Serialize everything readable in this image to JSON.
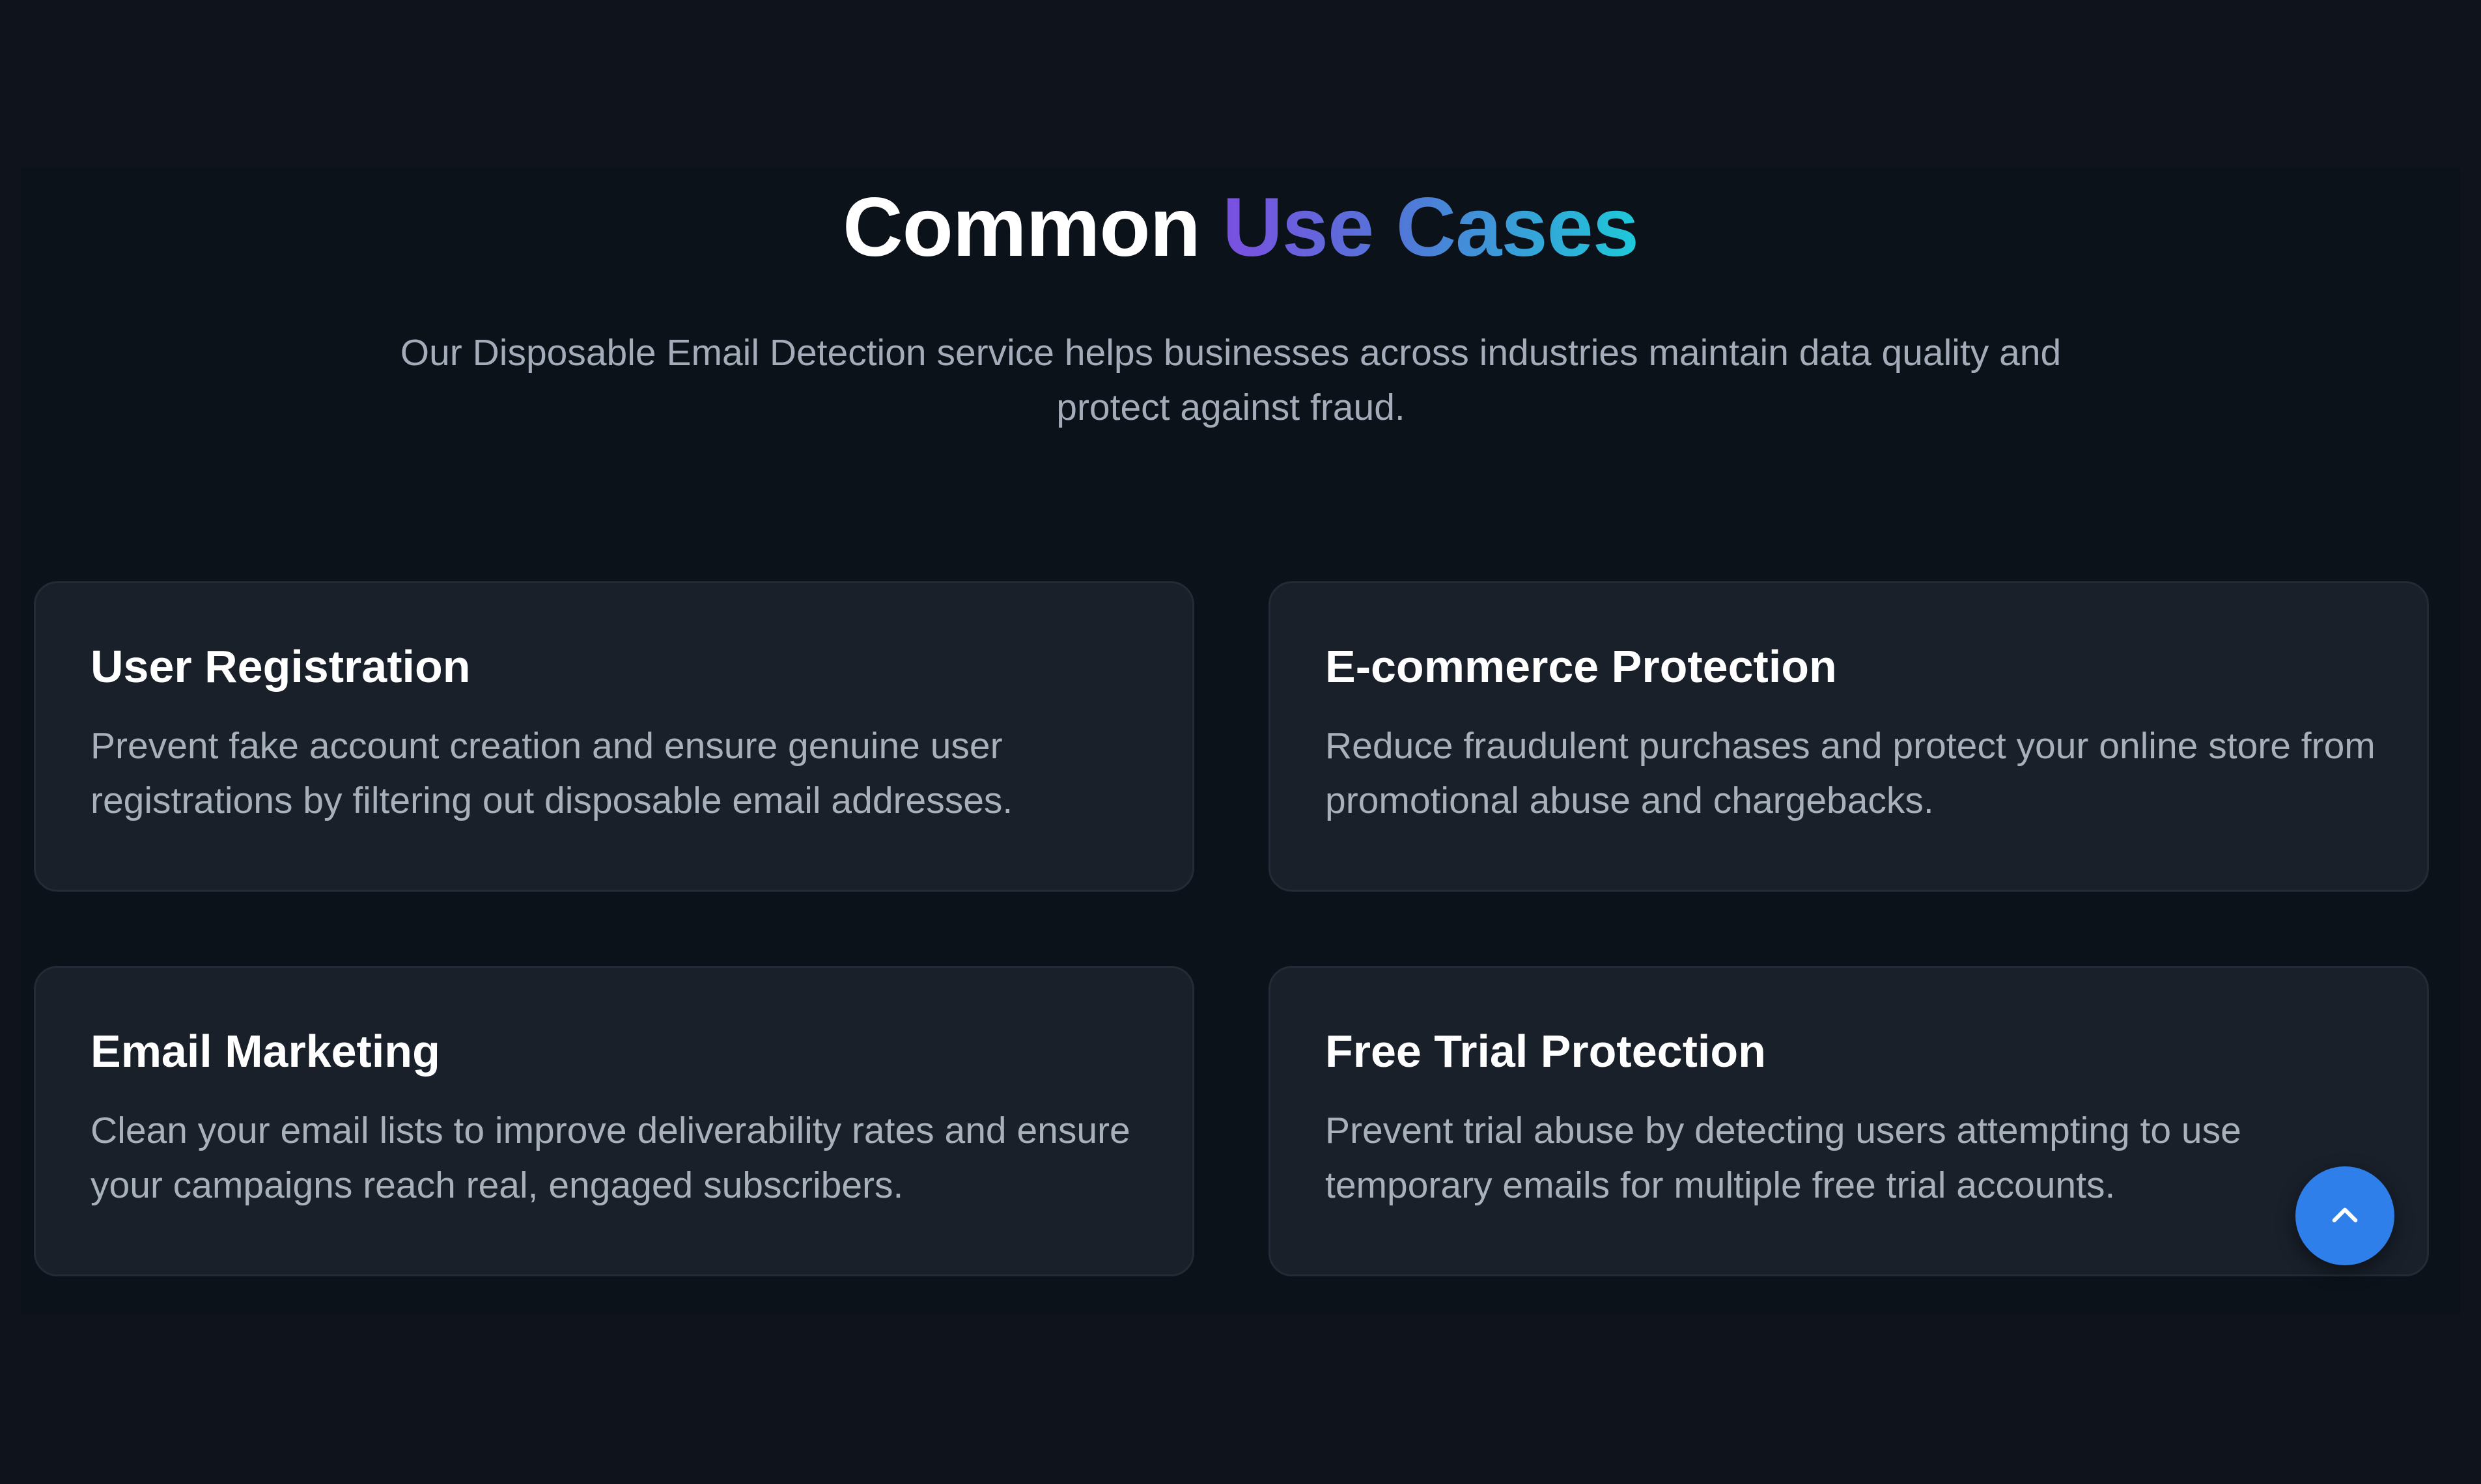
{
  "heading": {
    "part1": "Common ",
    "part2": "Use Cases"
  },
  "subtitle": "Our Disposable Email Detection service helps businesses across industries maintain data quality and protect against fraud.",
  "cards": [
    {
      "title": "User Registration",
      "description": "Prevent fake account creation and ensure genuine user registrations by filtering out disposable email addresses."
    },
    {
      "title": "E-commerce Protection",
      "description": "Reduce fraudulent purchases and protect your online store from promotional abuse and chargebacks."
    },
    {
      "title": "Email Marketing",
      "description": "Clean your email lists to improve deliverability rates and ensure your campaigns reach real, engaged subscribers."
    },
    {
      "title": "Free Trial Protection",
      "description": "Prevent trial abuse by detecting users attempting to use temporary emails for multiple free trial accounts."
    }
  ],
  "scroll_top": {
    "icon": "chevron-up-icon"
  },
  "colors": {
    "page_background": "#0f141c",
    "section_background": "#0c1219",
    "card_background": "#19202a",
    "accent_gradient_start": "#7b4fe0",
    "accent_gradient_end": "#1ec9d9",
    "button_blue": "#2f7fea"
  }
}
